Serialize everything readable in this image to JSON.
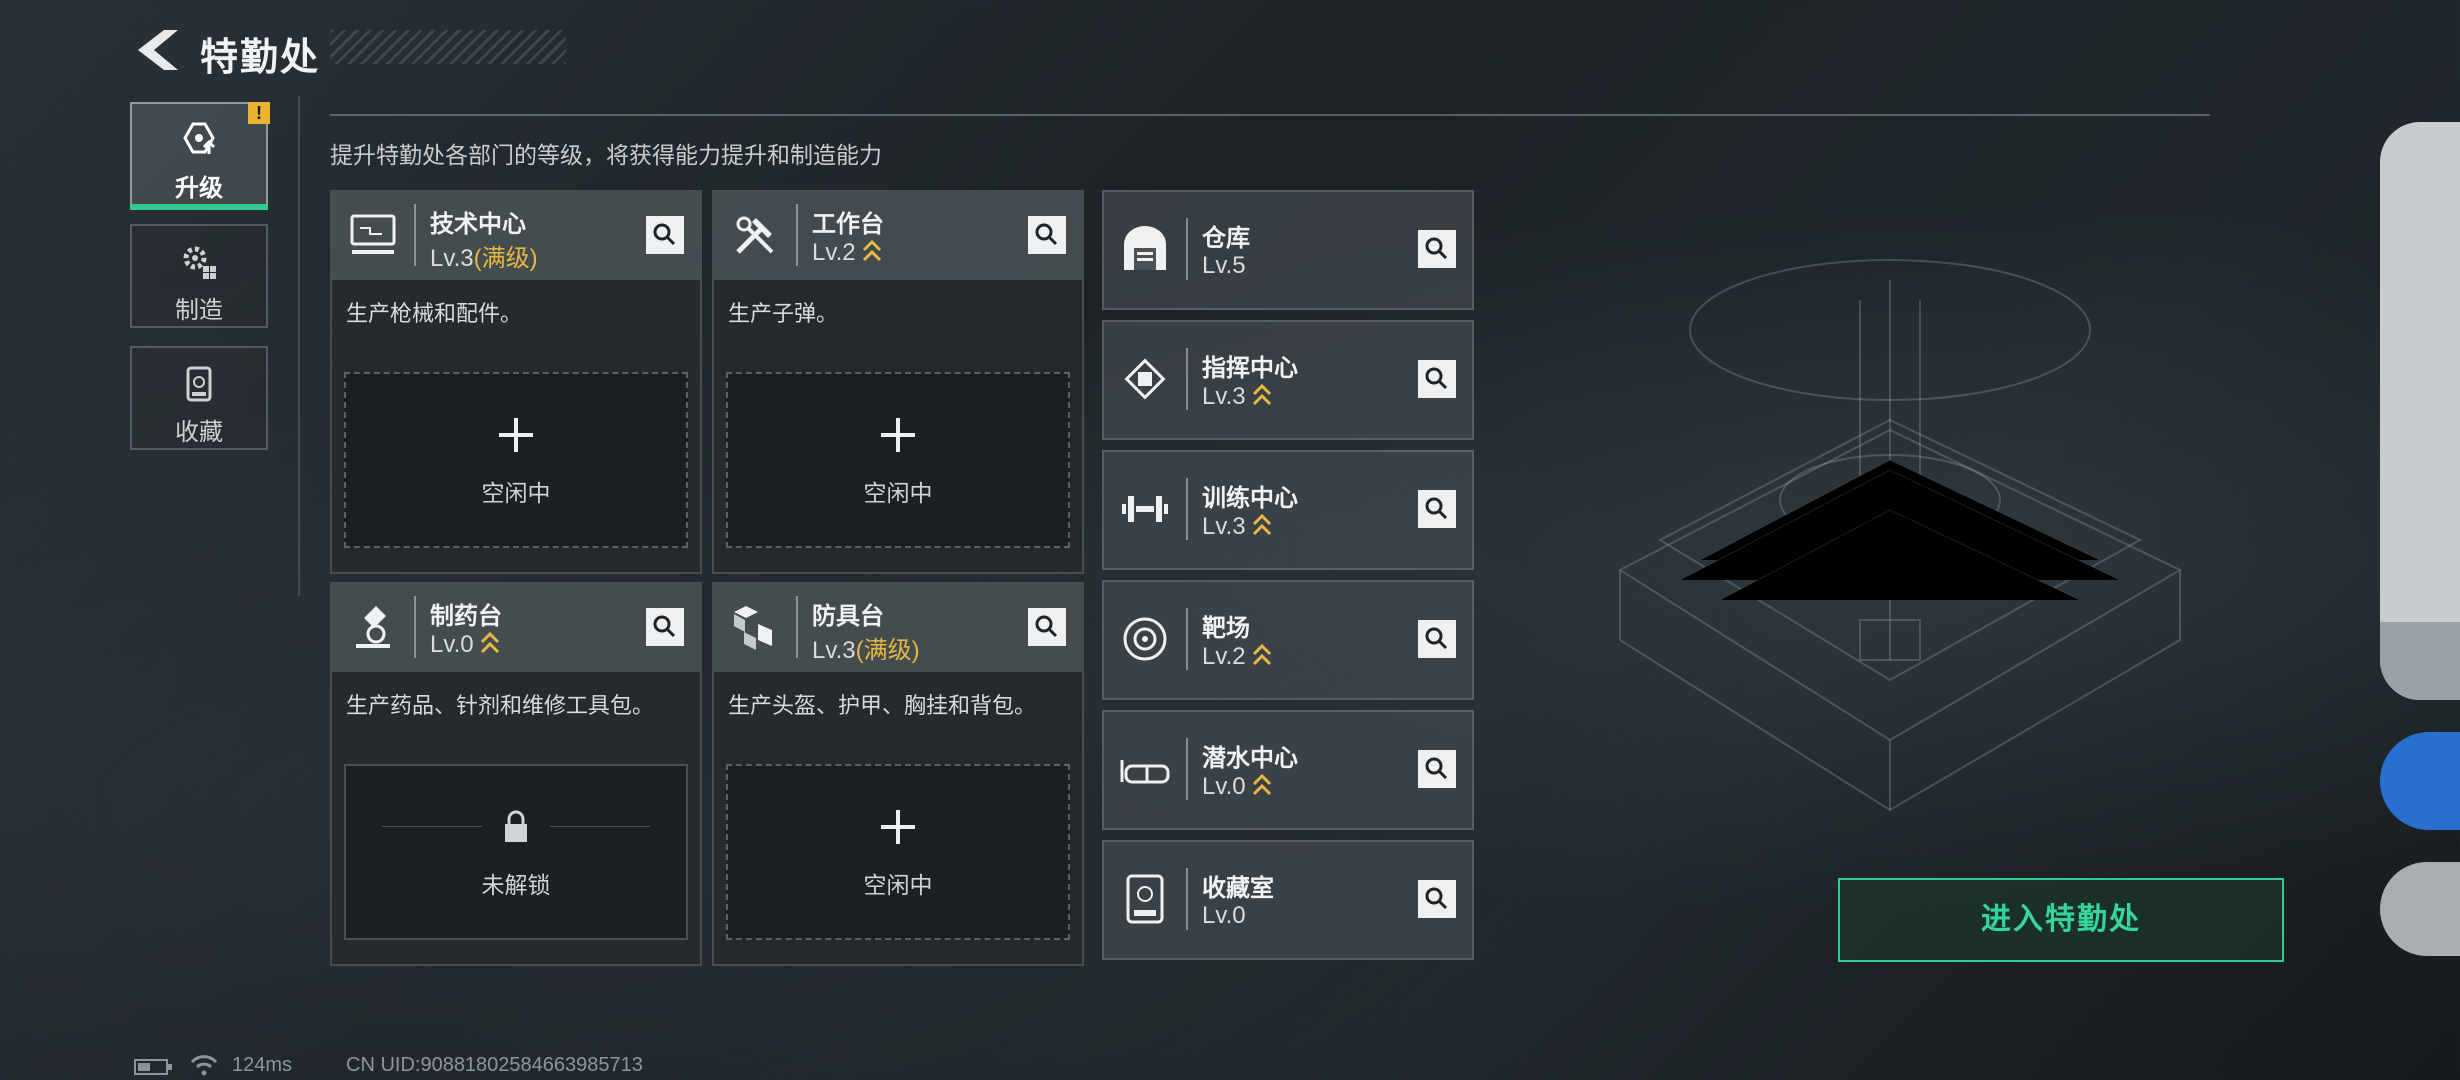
{
  "header": {
    "title": "特勤处"
  },
  "tabs": [
    {
      "label": "升级",
      "icon": "upgrade-icon",
      "active": true,
      "warning": "!"
    },
    {
      "label": "制造",
      "icon": "gears-icon"
    },
    {
      "label": "收藏",
      "icon": "collection-icon"
    }
  ],
  "subtitle": "提升特勤处各部门的等级，将获得能力提升和制造能力",
  "cards": [
    {
      "name": "技术中心",
      "level": "Lv.3",
      "max": "(满级)",
      "desc": "生产枪械和配件。",
      "slot": "空闲中",
      "icon": "computer-icon"
    },
    {
      "name": "工作台",
      "level": "Lv.2",
      "desc": "生产子弹。",
      "slot": "空闲中",
      "icon": "tools-icon"
    },
    {
      "name": "制药台",
      "level": "Lv.0",
      "desc": "生产药品、针剂和维修工具包。",
      "slot": "未解锁",
      "icon": "microscope-icon"
    },
    {
      "name": "防具台",
      "level": "Lv.3",
      "max": "(满级)",
      "desc": "生产头盔、护甲、胸挂和背包。",
      "slot": "空闲中",
      "icon": "boxes-icon"
    }
  ],
  "small_cards": [
    {
      "name": "仓库",
      "level": "Lv.5",
      "icon": "warehouse-icon"
    },
    {
      "name": "指挥中心",
      "level": "Lv.3",
      "icon": "chip-icon"
    },
    {
      "name": "训练中心",
      "level": "Lv.3",
      "icon": "dumbbell-icon"
    },
    {
      "name": "靶场",
      "level": "Lv.2",
      "icon": "target-icon"
    },
    {
      "name": "潜水中心",
      "level": "Lv.0",
      "icon": "goggles-icon"
    },
    {
      "name": "收藏室",
      "level": "Lv.0",
      "icon": "display-case-icon"
    }
  ],
  "enter_button": "进入特勤处",
  "status": {
    "ping": "124ms",
    "uid": "CN UID:90881802584663985713"
  },
  "colors": {
    "accent": "#2ecc8f",
    "max_level": "#e5b93f",
    "warning": "#e9b233"
  }
}
